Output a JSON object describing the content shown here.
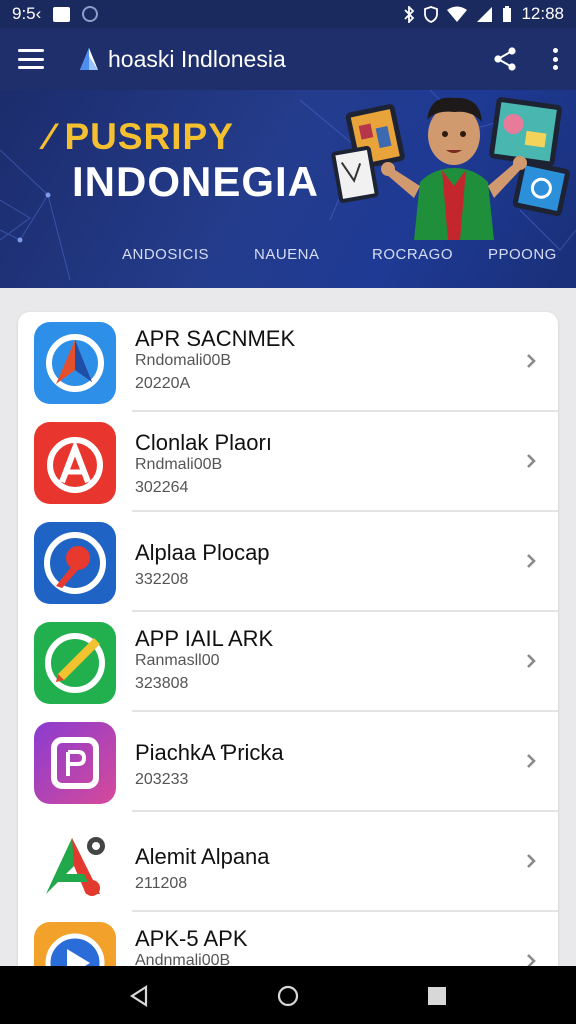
{
  "status_bar": {
    "time": "9:5‹",
    "clock": "12:88"
  },
  "app_bar": {
    "title": "hoaski Indlonesia",
    "menu_icon": "hamburger-menu-icon",
    "share_icon": "share-icon",
    "more_icon": "more-vert-icon"
  },
  "banner": {
    "headline_1": "⁄ PUSRIPY",
    "headline_2": "INDONEGIA",
    "tabs": [
      "ANDOSICIS",
      "NAUENA",
      "ROCRAGO",
      "PPOONG"
    ]
  },
  "apps": [
    {
      "title": "APR SACNMEK",
      "line2": "Rndomali00B",
      "line3": "20220A",
      "icon": "compass-a-icon"
    },
    {
      "title": "Clonlak Plaorı",
      "line2": "Rndmali00B",
      "line3": "302264",
      "icon": "a-circle-icon"
    },
    {
      "title": "Alplaa Plocap",
      "line2": "",
      "line3": "332208",
      "icon": "pin-icon"
    },
    {
      "title": "APP IAIL ARK",
      "line2": "Ranmasll00",
      "line3": "323808",
      "icon": "pencil-icon"
    },
    {
      "title": "PiachkA Ƥricka",
      "line2": "",
      "line3": "203233",
      "icon": "letter-p-icon"
    },
    {
      "title": "Alemit Alpana",
      "line2": "",
      "line3": "211208",
      "icon": "triangle-a-icon"
    },
    {
      "title": "APK-5 APK",
      "line2": "Andnmali00B",
      "line3": "",
      "icon": "play-icon"
    }
  ],
  "colors": {
    "app_bar": "#1e2f6b",
    "banner_yellow": "#f4c030",
    "page_bg": "#e9e9ec"
  }
}
